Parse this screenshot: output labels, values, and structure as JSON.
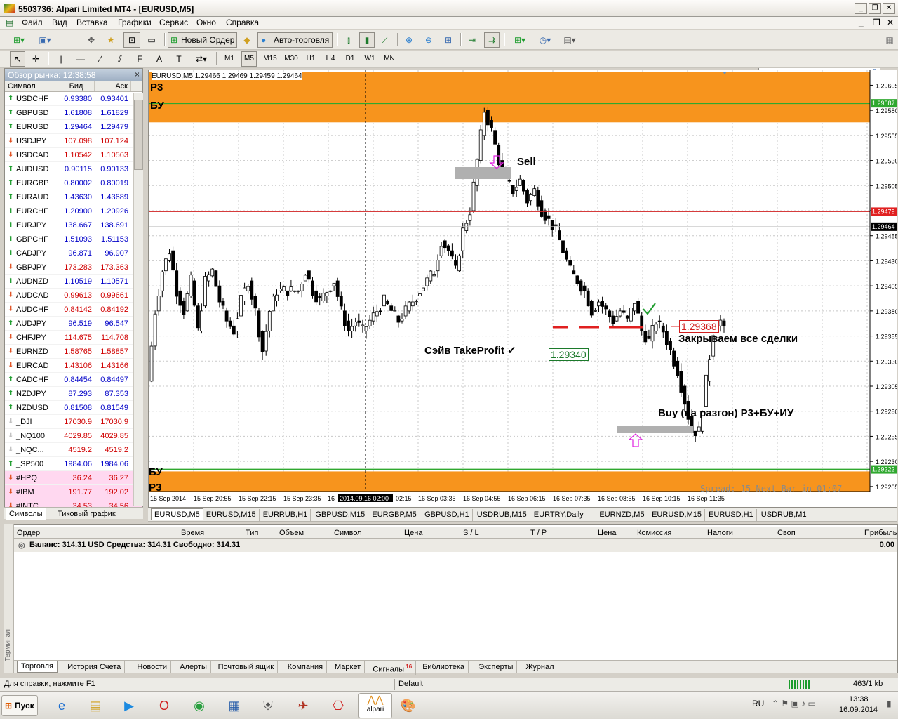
{
  "window": {
    "title": "5503736: Alpari Limited MT4 - [EURUSD,M5]"
  },
  "menu": [
    "Файл",
    "Вид",
    "Вставка",
    "Графики",
    "Сервис",
    "Окно",
    "Справка"
  ],
  "toolbar": {
    "new_order": "Новый Ордер",
    "auto_trading": "Авто-торговля"
  },
  "timeframes": [
    "M1",
    "M5",
    "M15",
    "M30",
    "H1",
    "H4",
    "D1",
    "W1",
    "MN"
  ],
  "active_timeframe": "M5",
  "market_watch": {
    "title": "Обзор рынка: 12:38:58",
    "columns": [
      "Символ",
      "Бид",
      "Аск"
    ],
    "rows": [
      {
        "symbol": "USDCHF",
        "bid": "0.93380",
        "ask": "0.93401",
        "dir": "up",
        "color": "#0000c8"
      },
      {
        "symbol": "GBPUSD",
        "bid": "1.61808",
        "ask": "1.61829",
        "dir": "up",
        "color": "#0000c8"
      },
      {
        "symbol": "EURUSD",
        "bid": "1.29464",
        "ask": "1.29479",
        "dir": "up",
        "color": "#0000c8"
      },
      {
        "symbol": "USDJPY",
        "bid": "107.098",
        "ask": "107.124",
        "dir": "down",
        "color": "#d00000"
      },
      {
        "symbol": "USDCAD",
        "bid": "1.10542",
        "ask": "1.10563",
        "dir": "down",
        "color": "#d00000"
      },
      {
        "symbol": "AUDUSD",
        "bid": "0.90115",
        "ask": "0.90133",
        "dir": "up",
        "color": "#0000c8"
      },
      {
        "symbol": "EURGBP",
        "bid": "0.80002",
        "ask": "0.80019",
        "dir": "up",
        "color": "#0000c8"
      },
      {
        "symbol": "EURAUD",
        "bid": "1.43630",
        "ask": "1.43689",
        "dir": "up",
        "color": "#0000c8"
      },
      {
        "symbol": "EURCHF",
        "bid": "1.20900",
        "ask": "1.20926",
        "dir": "up",
        "color": "#0000c8"
      },
      {
        "symbol": "EURJPY",
        "bid": "138.667",
        "ask": "138.691",
        "dir": "up",
        "color": "#0000c8"
      },
      {
        "symbol": "GBPCHF",
        "bid": "1.51093",
        "ask": "1.51153",
        "dir": "up",
        "color": "#0000c8"
      },
      {
        "symbol": "CADJPY",
        "bid": "96.871",
        "ask": "96.907",
        "dir": "up",
        "color": "#0000c8"
      },
      {
        "symbol": "GBPJPY",
        "bid": "173.283",
        "ask": "173.363",
        "dir": "down",
        "color": "#d00000"
      },
      {
        "symbol": "AUDNZD",
        "bid": "1.10519",
        "ask": "1.10571",
        "dir": "up",
        "color": "#0000c8"
      },
      {
        "symbol": "AUDCAD",
        "bid": "0.99613",
        "ask": "0.99661",
        "dir": "down",
        "color": "#d00000"
      },
      {
        "symbol": "AUDCHF",
        "bid": "0.84142",
        "ask": "0.84192",
        "dir": "down",
        "color": "#d00000"
      },
      {
        "symbol": "AUDJPY",
        "bid": "96.519",
        "ask": "96.547",
        "dir": "up",
        "color": "#0000c8"
      },
      {
        "symbol": "CHFJPY",
        "bid": "114.675",
        "ask": "114.708",
        "dir": "down",
        "color": "#d00000"
      },
      {
        "symbol": "EURNZD",
        "bid": "1.58765",
        "ask": "1.58857",
        "dir": "down",
        "color": "#d00000"
      },
      {
        "symbol": "EURCAD",
        "bid": "1.43106",
        "ask": "1.43166",
        "dir": "down",
        "color": "#d00000"
      },
      {
        "symbol": "CADCHF",
        "bid": "0.84454",
        "ask": "0.84497",
        "dir": "up",
        "color": "#0000c8"
      },
      {
        "symbol": "NZDJPY",
        "bid": "87.293",
        "ask": "87.353",
        "dir": "up",
        "color": "#0000c8"
      },
      {
        "symbol": "NZDUSD",
        "bid": "0.81508",
        "ask": "0.81549",
        "dir": "up",
        "color": "#0000c8"
      },
      {
        "symbol": "_DJI",
        "bid": "17030.9",
        "ask": "17030.9",
        "dir": "down-gray",
        "color": "#d00000"
      },
      {
        "symbol": "_NQ100",
        "bid": "4029.85",
        "ask": "4029.85",
        "dir": "down-gray",
        "color": "#d00000"
      },
      {
        "symbol": "_NQC...",
        "bid": "4519.2",
        "ask": "4519.2",
        "dir": "down-gray",
        "color": "#d00000"
      },
      {
        "symbol": "_SP500",
        "bid": "1984.06",
        "ask": "1984.06",
        "dir": "up",
        "color": "#0000c8"
      },
      {
        "symbol": "#HPQ",
        "bid": "36.24",
        "ask": "36.27",
        "dir": "down",
        "color": "#d00000",
        "pink": true
      },
      {
        "symbol": "#IBM",
        "bid": "191.77",
        "ask": "192.02",
        "dir": "down",
        "color": "#d00000",
        "pink": true
      },
      {
        "symbol": "#INTC",
        "bid": "34.53",
        "ask": "34.56",
        "dir": "down",
        "color": "#d00000",
        "pink": true
      }
    ],
    "tabs": [
      "Символы",
      "Тиковый график"
    ]
  },
  "chart": {
    "info": "EURUSD,M5  1.29466 1.29469 1.29459 1.29464",
    "labels": {
      "p3_top": "P3",
      "bu_top": "БУ",
      "bu_bottom": "БУ",
      "p3_bottom": "P3",
      "sell": "Sell",
      "save_tp": "Сэйв TakeProfit ✓",
      "close_all": "Закрываем все сделки",
      "buy": "Buy (на разгон) P3+БУ+ИУ",
      "price_1": "1.29340",
      "price_2": "1.29368",
      "spread": "Spread: 15  Next Bar in 01:07"
    },
    "price_levels": {
      "green_top": "1.29587",
      "ask": "1.29479",
      "bid": "1.29464",
      "green_bottom": "1.29222"
    },
    "time_labels": [
      "15 Sep 2014",
      "15 Sep 20:55",
      "15 Sep 22:15",
      "15 Sep 23:35",
      "16",
      "2014.09.16 02:00",
      "02:15",
      "16 Sep 03:35",
      "16 Sep 04:55",
      "16 Sep 06:15",
      "16 Sep 07:35",
      "16 Sep 08:55",
      "16 Sep 10:15",
      "16 Sep 11:35"
    ]
  },
  "chart_data": {
    "type": "candlestick",
    "title": "EURUSD,M5",
    "y_ticks": [
      "1.29605",
      "1.29580",
      "1.29555",
      "1.29530",
      "1.29505",
      "1.29480",
      "1.29455",
      "1.29430",
      "1.29405",
      "1.29380",
      "1.29355",
      "1.29330",
      "1.29305",
      "1.29280",
      "1.29255",
      "1.29230",
      "1.29205"
    ],
    "ylim": [
      1.292,
      1.2962
    ],
    "zones": [
      {
        "name": "P3",
        "from": 1.29568,
        "to": 1.29618
      },
      {
        "name": "P3",
        "from": 1.29196,
        "to": 1.2922
      }
    ],
    "lines": [
      {
        "name": "БУ",
        "value": 1.29587,
        "color": "#2fa82f"
      },
      {
        "name": "ask",
        "value": 1.29479,
        "color": "#d02020"
      },
      {
        "name": "БУ",
        "value": 1.29222,
        "color": "#2fa82f"
      }
    ],
    "close_path": [
      1.2931,
      1.2938,
      1.2942,
      1.2944,
      1.294,
      1.2938,
      1.2941,
      1.2936,
      1.2941,
      1.2942,
      1.2939,
      1.2937,
      1.2936,
      1.2939,
      1.2941,
      1.2938,
      1.2934,
      1.2938,
      1.294,
      1.294,
      1.294,
      1.294,
      1.2942,
      1.294,
      1.2939,
      1.294,
      1.2941,
      1.2938,
      1.2936,
      1.2937,
      1.2936,
      1.2937,
      1.2938,
      1.2939,
      1.2938,
      1.2937,
      1.2938,
      1.2939,
      1.294,
      1.2941,
      1.2942,
      1.2945,
      1.2944,
      1.2942,
      1.2946,
      1.2948,
      1.2953,
      1.2958,
      1.2956,
      1.2953,
      1.2951,
      1.295,
      1.2951,
      1.2949,
      1.295,
      1.2948,
      1.2947,
      1.2946,
      1.2944,
      1.2942,
      1.2941,
      1.294,
      1.2938,
      1.2939,
      1.2938,
      1.2937,
      1.2938,
      1.2937,
      1.2939,
      1.2936,
      1.2935,
      1.2937,
      1.2936,
      1.2934,
      1.2932,
      1.2929,
      1.2926,
      1.2926,
      1.2931,
      1.2936,
      1.2937,
      1.2935,
      1.2933,
      1.2935,
      1.2941,
      1.294,
      1.2941,
      1.2943,
      1.2942,
      1.2944,
      1.2942,
      1.294,
      1.2945,
      1.2947,
      1.2946
    ]
  },
  "chart_tabs": [
    "EURUSD,M5",
    "EURUSD,M15",
    "EURRUB,H1",
    "GBPUSD,M15",
    "EURGBP,M5",
    "GBPUSD,H1",
    "USDRUB,M15",
    "EURTRY,Daily",
    "EURNZD,M5",
    "EURUSD,M15",
    "EURUSD,H1",
    "USDRUB,M1"
  ],
  "terminal": {
    "columns": [
      "Ордер",
      "Время",
      "Тип",
      "Объем",
      "Символ",
      "Цена",
      "S / L",
      "T / P",
      "Цена",
      "Комиссия",
      "Налоги",
      "Своп",
      "Прибыль"
    ],
    "balance": "Баланс: 314.31 USD  Средства: 314.31  Свободно: 314.31",
    "profit": "0.00",
    "side_label": "Терминал",
    "tabs": [
      "Торговля",
      "История Счета",
      "Новости",
      "Алерты",
      "Почтовый ящик",
      "Компания",
      "Маркет",
      "Сигналы",
      "Библиотека",
      "Эксперты",
      "Журнал"
    ],
    "signals_badge": "16"
  },
  "status": {
    "help": "Для справки, нажмите F1",
    "profile": "Default",
    "traffic": "463/1 kb"
  },
  "taskbar": {
    "start": "Пуск",
    "lang": "RU",
    "time": "13:38",
    "date": "16.09.2014",
    "alpari": "alpari"
  }
}
